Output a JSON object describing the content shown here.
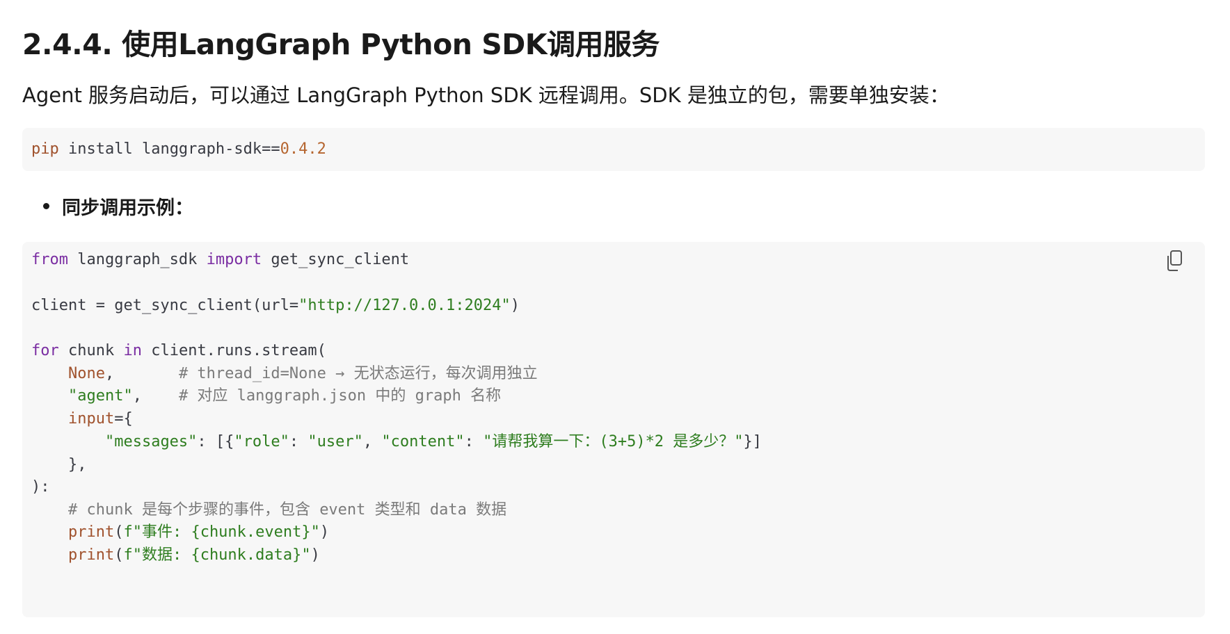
{
  "section": {
    "title": "2.4.4. 使用LangGraph Python SDK调用服务"
  },
  "intro": {
    "text": "Agent 服务启动后，可以通过 LangGraph Python SDK 远程调用。SDK 是独立的包，需要单独安装："
  },
  "install_code": {
    "cmd": "pip",
    "rest": " install langgraph-sdk==",
    "version": "0.4.2"
  },
  "bullet": {
    "label": "同步调用示例："
  },
  "example_code": {
    "copy_icon": "copy-icon",
    "l1_kw1": "from",
    "l1_mod": " langgraph_sdk ",
    "l1_kw2": "import",
    "l1_name": " get_sync_client",
    "l2_pre": "client = get_sync_client(url=",
    "l2_str": "\"http://127.0.0.1:2024\"",
    "l2_post": ")",
    "l3_kw1": "for",
    "l3_mid": " chunk ",
    "l3_kw2": "in",
    "l3_post": " client.runs.stream(",
    "l4_indent": "    ",
    "l4_val": "None",
    "l4_sep": ",       ",
    "l4_cmt": "# thread_id=None → 无状态运行，每次调用独立",
    "l5_indent": "    ",
    "l5_str": "\"agent\"",
    "l5_sep": ",    ",
    "l5_cmt": "# 对应 langgraph.json 中的 graph 名称",
    "l6_indent": "    ",
    "l6_kw": "input",
    "l6_post": "={",
    "l7_indent": "        ",
    "l7_k1": "\"messages\"",
    "l7_p1": ": [{",
    "l7_k2": "\"role\"",
    "l7_p2": ": ",
    "l7_v2": "\"user\"",
    "l7_p3": ", ",
    "l7_k3": "\"content\"",
    "l7_p4": ": ",
    "l7_v3": "\"请帮我算一下：(3+5)*2 是多少？\"",
    "l7_p5": "}]",
    "l8": "    },",
    "l9": "):",
    "l10_indent": "    ",
    "l10_cmt": "# chunk 是每个步骤的事件，包含 event 类型和 data 数据",
    "l11_indent": "    ",
    "l11_fn": "print",
    "l11_p1": "(",
    "l11_str": "f\"事件: {chunk.event}\"",
    "l11_p2": ")",
    "l12_indent": "    ",
    "l12_fn": "print",
    "l12_p1": "(",
    "l12_str": "f\"数据: {chunk.data}\"",
    "l12_p2": ")"
  },
  "colors": {
    "keyword": "#7a2da2",
    "variable": "#a0522d",
    "string": "#2e7d1f",
    "number": "#b5652f",
    "comment": "#7a7a7a",
    "code_bg": "#f7f7f7"
  }
}
